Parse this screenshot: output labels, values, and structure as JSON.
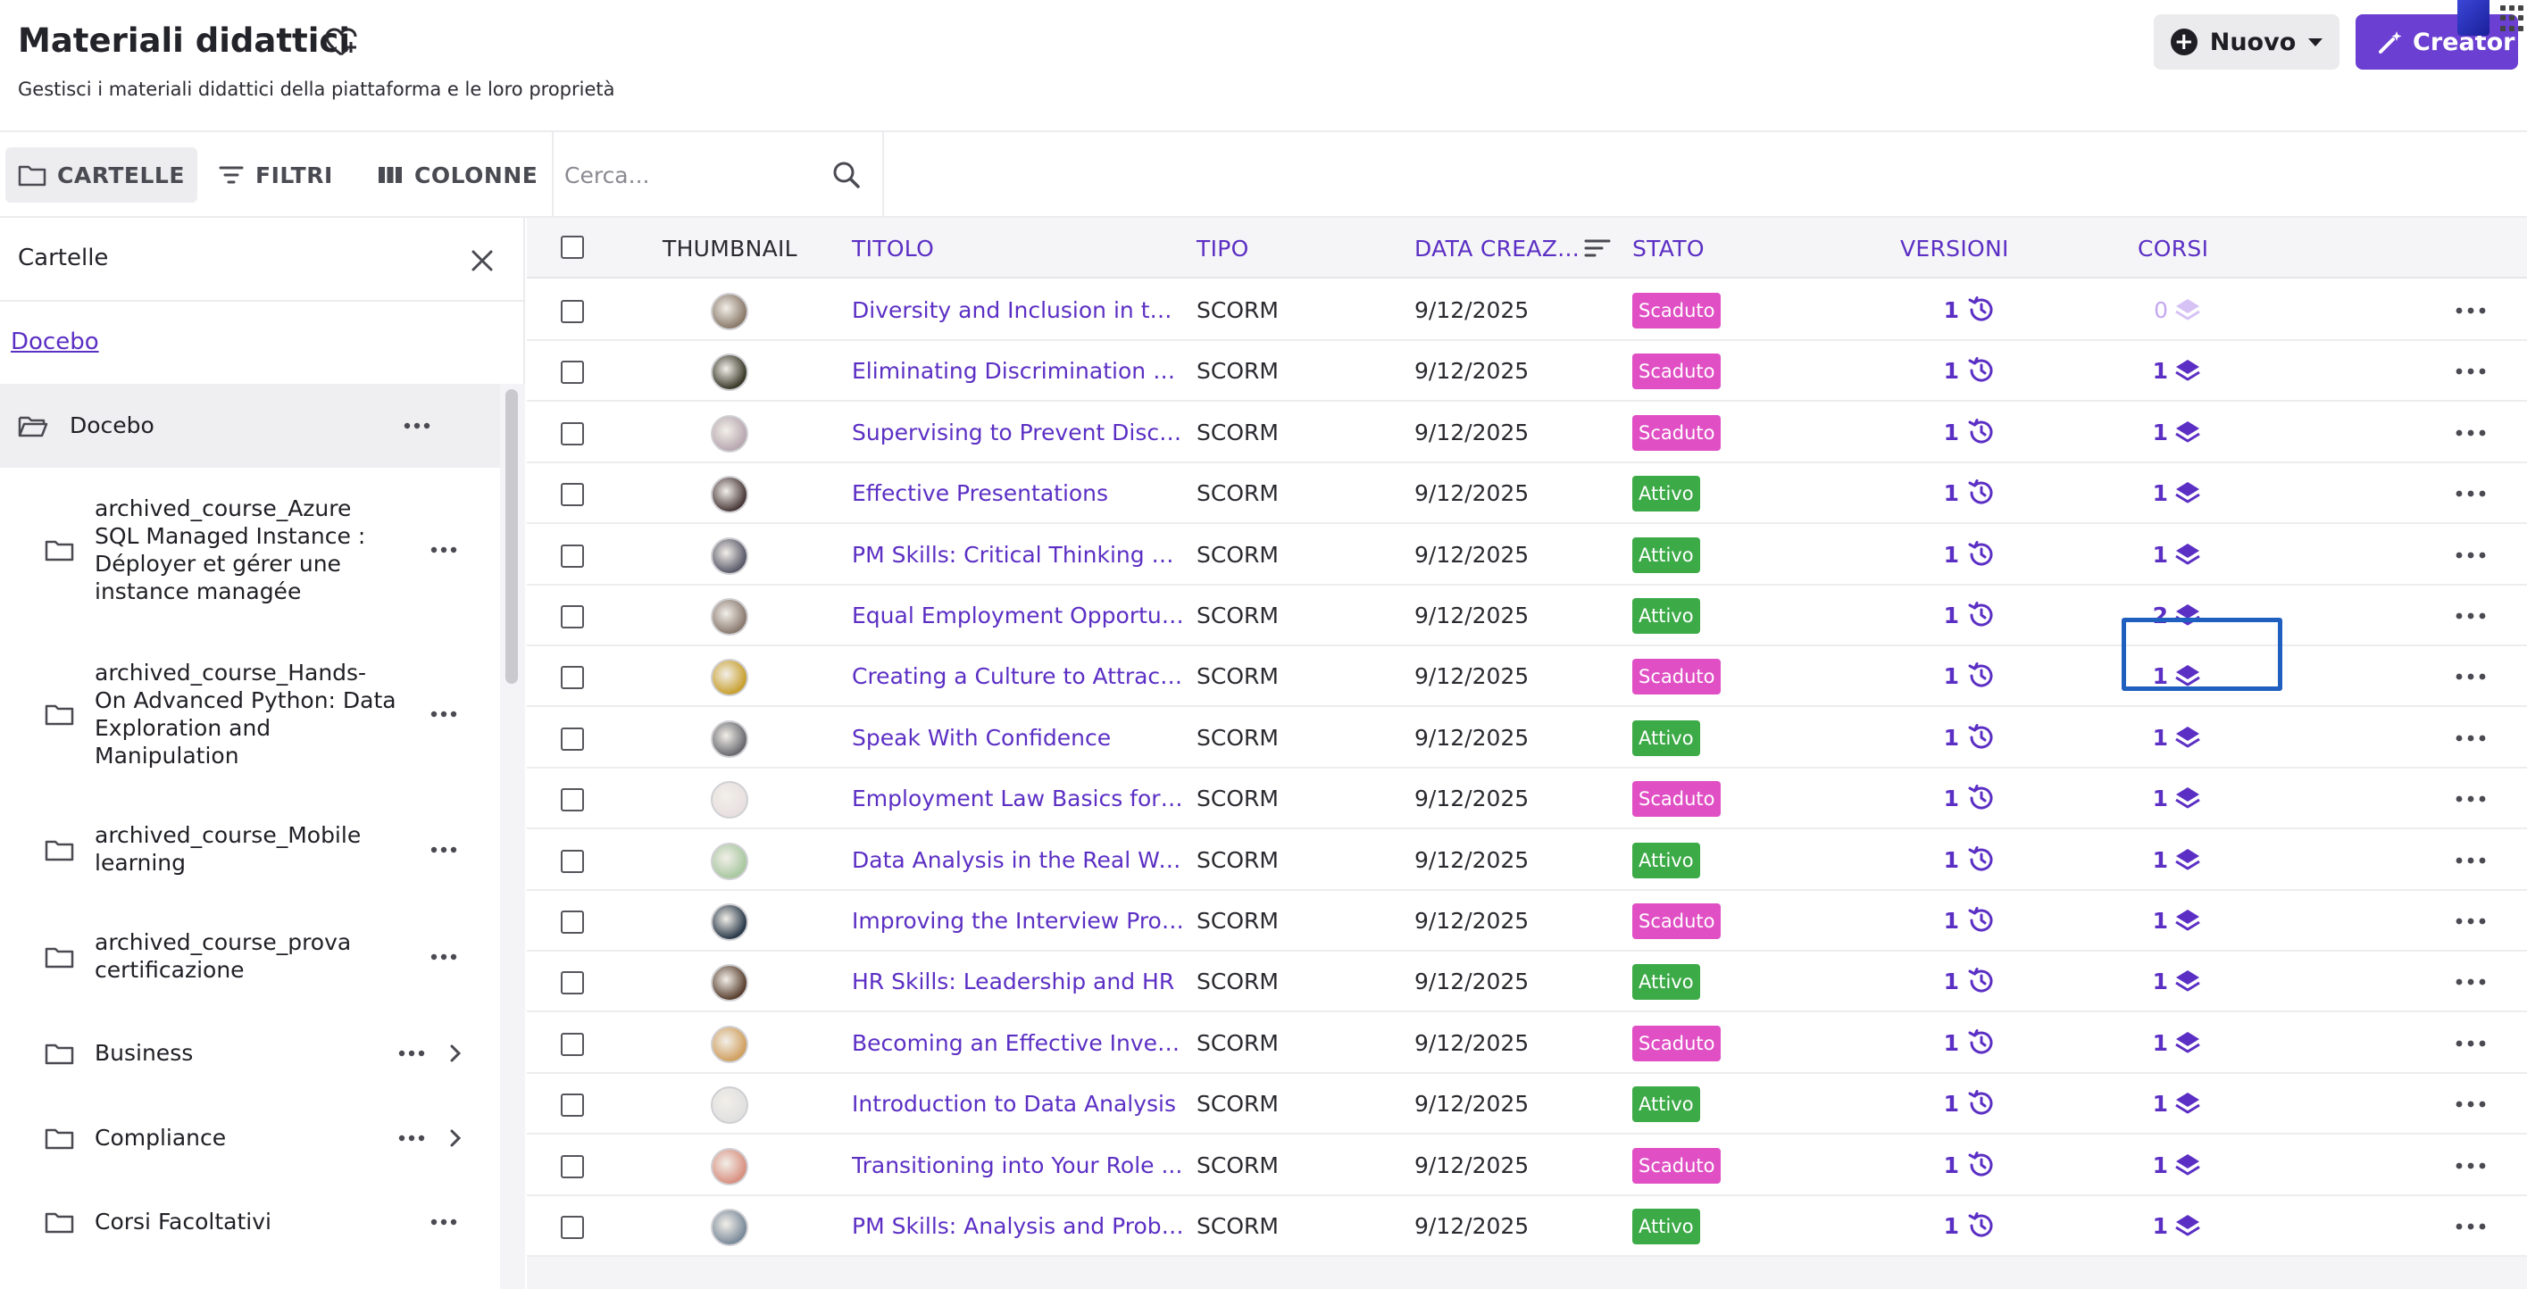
{
  "header": {
    "title": "Materiali didattici",
    "subtitle": "Gestisci i materiali didattici della piattaforma e le loro proprietà",
    "new_button": "Nuovo",
    "creator_button": "Creator"
  },
  "toolbar": {
    "folders": "CARTELLE",
    "filters": "FILTRI",
    "columns": "COLONNE",
    "search_placeholder": "Cerca..."
  },
  "sidebar": {
    "title": "Cartelle",
    "breadcrumb": "Docebo",
    "items": [
      {
        "label": "Docebo",
        "selected": true
      },
      {
        "label": "archived_course_Azure SQL Managed Instance : Déployer et gérer une instance managée"
      },
      {
        "label": "archived_course_Hands-On Advanced Python: Data Exploration and Manipulation"
      },
      {
        "label": "archived_course_Mobile learning"
      },
      {
        "label": "archived_course_prova certificazione"
      },
      {
        "label": "Business",
        "has_children": true
      },
      {
        "label": "Compliance",
        "has_children": true
      },
      {
        "label": "Corsi Facoltativi"
      }
    ]
  },
  "table": {
    "headers": {
      "thumbnail": "THUMBNAIL",
      "title": "TITOLO",
      "type": "TIPO",
      "created": "DATA CREAZ...",
      "status": "STATO",
      "versions": "VERSIONI",
      "courses": "CORSI"
    },
    "status_colors": {
      "Scaduto": "#e04fc4",
      "Attivo": "#3daa48"
    },
    "rows": [
      {
        "title": "Diversity and Inclusion in the ...",
        "type": "SCORM",
        "date": "9/12/2025",
        "status": "Scaduto",
        "versions": "1",
        "courses": "0",
        "thumb_color": "#8a7a6a"
      },
      {
        "title": "Eliminating Discrimination an...",
        "type": "SCORM",
        "date": "9/12/2025",
        "status": "Scaduto",
        "versions": "1",
        "courses": "1",
        "thumb_color": "#3a3a2a"
      },
      {
        "title": "Supervising to Prevent Discri...",
        "type": "SCORM",
        "date": "9/12/2025",
        "status": "Scaduto",
        "versions": "1",
        "courses": "1",
        "thumb_color": "#b8a8b0"
      },
      {
        "title": "Effective Presentations",
        "type": "SCORM",
        "date": "9/12/2025",
        "status": "Attivo",
        "versions": "1",
        "courses": "1",
        "thumb_color": "#4a3a3a"
      },
      {
        "title": "PM Skills: Critical Thinking an...",
        "type": "SCORM",
        "date": "9/12/2025",
        "status": "Attivo",
        "versions": "1",
        "courses": "1",
        "thumb_color": "#5a5a6a"
      },
      {
        "title": "Equal Employment Opportun...",
        "type": "SCORM",
        "date": "9/12/2025",
        "status": "Attivo",
        "versions": "1",
        "courses": "2",
        "thumb_color": "#8a7a70"
      },
      {
        "title": "Creating a Culture to Attract ...",
        "type": "SCORM",
        "date": "9/12/2025",
        "status": "Scaduto",
        "versions": "1",
        "courses": "1",
        "thumb_color": "#c8a030"
      },
      {
        "title": "Speak With Confidence",
        "type": "SCORM",
        "date": "9/12/2025",
        "status": "Attivo",
        "versions": "1",
        "courses": "1",
        "thumb_color": "#6a6a70"
      },
      {
        "title": "Employment Law Basics for ...",
        "type": "SCORM",
        "date": "9/12/2025",
        "status": "Scaduto",
        "versions": "1",
        "courses": "1",
        "thumb_color": "#e8e0e0"
      },
      {
        "title": "Data Analysis in the Real World",
        "type": "SCORM",
        "date": "9/12/2025",
        "status": "Attivo",
        "versions": "1",
        "courses": "1",
        "thumb_color": "#a8c8a0"
      },
      {
        "title": "Improving the Interview Proc...",
        "type": "SCORM",
        "date": "9/12/2025",
        "status": "Scaduto",
        "versions": "1",
        "courses": "1",
        "thumb_color": "#2a3a4a"
      },
      {
        "title": "HR Skills: Leadership and HR",
        "type": "SCORM",
        "date": "9/12/2025",
        "status": "Attivo",
        "versions": "1",
        "courses": "1",
        "thumb_color": "#5a4030"
      },
      {
        "title": "Becoming an Effective Investi...",
        "type": "SCORM",
        "date": "9/12/2025",
        "status": "Scaduto",
        "versions": "1",
        "courses": "1",
        "thumb_color": "#d0a060"
      },
      {
        "title": "Introduction to Data Analysis",
        "type": "SCORM",
        "date": "9/12/2025",
        "status": "Attivo",
        "versions": "1",
        "courses": "1",
        "thumb_color": "#e0e0e0"
      },
      {
        "title": "Transitioning into Your Role ...",
        "type": "SCORM",
        "date": "9/12/2025",
        "status": "Scaduto",
        "versions": "1",
        "courses": "1",
        "thumb_color": "#d89080"
      },
      {
        "title": "PM Skills: Analysis and Proble...",
        "type": "SCORM",
        "date": "9/12/2025",
        "status": "Attivo",
        "versions": "1",
        "courses": "1",
        "thumb_color": "#7a8a9a"
      }
    ]
  }
}
